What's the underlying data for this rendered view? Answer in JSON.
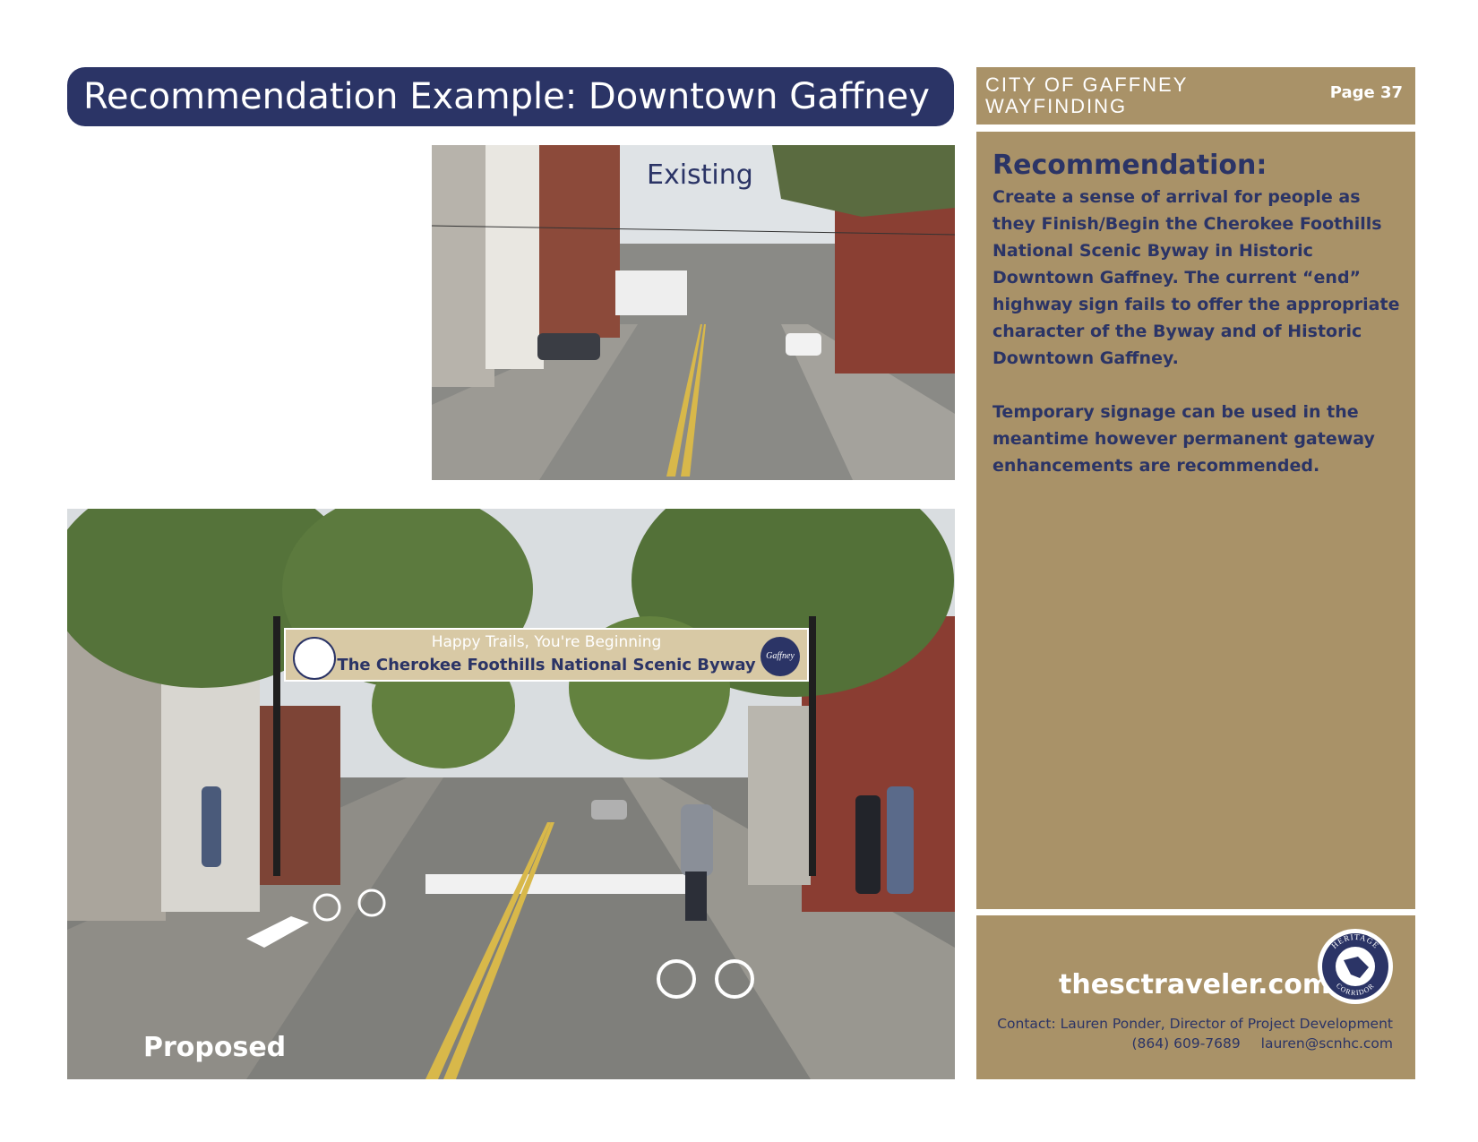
{
  "title": "Recommendation Example: Downtown Gaffney",
  "header": {
    "org_line1": "CITY OF GAFFNEY",
    "org_line2": "WAYFINDING",
    "page": "Page 37"
  },
  "recommendation": {
    "heading": "Recommendation:",
    "paragraph1": "Create a sense of arrival for people as they Finish/Begin the Cherokee Foothills National Scenic Byway in Historic Downtown Gaffney. The current “end” highway sign fails to offer the appropriate character of the Byway and of Historic Downtown Gaffney.",
    "paragraph2": "Temporary signage  can be used in the meantime however permanent gateway enhancements are recommended."
  },
  "footer": {
    "website": "thesctraveler.com",
    "badge_text_top": "HERITAGE",
    "badge_text_bottom": "CORRIDOR",
    "contact_line": "Contact: Lauren Ponder, Director of Project Development",
    "phone": "(864) 609-7689",
    "email": "lauren@scnhc.com"
  },
  "photos": {
    "existing_label": "Existing",
    "proposed_label": "Proposed",
    "banner_line1": "Happy Trails, You're Beginning",
    "banner_line2": "The Cherokee Foothills National Scenic Byway",
    "banner_logo_right_text": "Gaffney"
  },
  "colors": {
    "navy": "#2b3466",
    "tan": "#a99268"
  }
}
